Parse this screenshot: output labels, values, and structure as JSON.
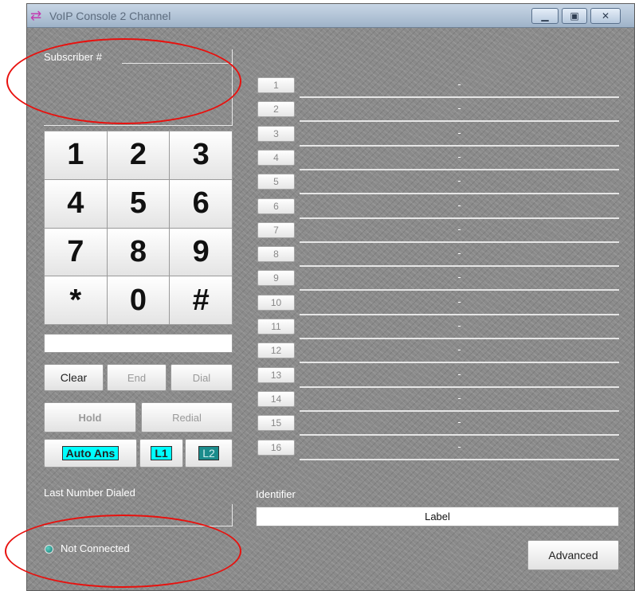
{
  "window": {
    "title": "VoIP Console 2 Channel",
    "icon": "arrows-icon"
  },
  "subscriber": {
    "label": "Subscriber #",
    "value": ""
  },
  "keypad": {
    "keys": [
      "1",
      "2",
      "3",
      "4",
      "5",
      "6",
      "7",
      "8",
      "9",
      "*",
      "0",
      "#"
    ]
  },
  "dial_field": {
    "value": ""
  },
  "buttons": {
    "clear": "Clear",
    "end": "End",
    "dial": "Dial",
    "hold": "Hold",
    "redial": "Redial",
    "auto_ans": "Auto Ans",
    "l1": "L1",
    "l2": "L2",
    "advanced": "Advanced"
  },
  "speed_dial": [
    {
      "num": "1",
      "value": "-"
    },
    {
      "num": "2",
      "value": "-"
    },
    {
      "num": "3",
      "value": "-"
    },
    {
      "num": "4",
      "value": "-"
    },
    {
      "num": "5",
      "value": "-"
    },
    {
      "num": "6",
      "value": "-"
    },
    {
      "num": "7",
      "value": "-"
    },
    {
      "num": "8",
      "value": "-"
    },
    {
      "num": "9",
      "value": "-"
    },
    {
      "num": "10",
      "value": "-"
    },
    {
      "num": "11",
      "value": "-"
    },
    {
      "num": "12",
      "value": "-"
    },
    {
      "num": "13",
      "value": "-"
    },
    {
      "num": "14",
      "value": "-"
    },
    {
      "num": "15",
      "value": "-"
    },
    {
      "num": "16",
      "value": "-"
    }
  ],
  "last_dialed": {
    "label": "Last Number Dialed",
    "value": ""
  },
  "identifier": {
    "label": "Identifier",
    "value": "Label"
  },
  "status": {
    "text": "Not Connected",
    "color": "#2a9d92"
  },
  "colors": {
    "toggle_on": "#00ffff",
    "toggle_off": "#1a8c8c",
    "annotation": "#e8110e"
  }
}
